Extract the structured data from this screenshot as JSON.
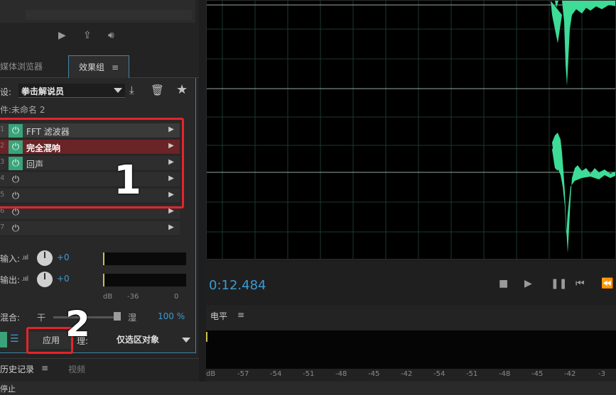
{
  "effects_rack": {
    "tabs": {
      "media_browser": "媒体浏览器",
      "effects_group": "效果组",
      "menu": "≡"
    },
    "preset_label": "设:",
    "preset_value": "拳击解说员",
    "file_label": "件:未命名 2",
    "slots": [
      {
        "num": "1",
        "name": "FFT 滤波器",
        "power_on": true
      },
      {
        "num": "2",
        "name": "完全混响",
        "power_on": true
      },
      {
        "num": "3",
        "name": "回声",
        "power_on": true
      },
      {
        "num": "4",
        "name": "",
        "power_on": false
      },
      {
        "num": "5",
        "name": "",
        "power_on": false
      },
      {
        "num": "6",
        "name": "",
        "power_on": false
      },
      {
        "num": "7",
        "name": "",
        "power_on": false
      }
    ],
    "input_label": "输入:",
    "input_value": "+0",
    "output_label": "输出:",
    "output_value": "+0",
    "meter_scale": [
      "dB",
      "-36",
      "0"
    ],
    "mix_label": "混合:",
    "mix_dry": "干",
    "mix_wet": "湿",
    "mix_value": "100 %",
    "apply_label": "应用",
    "process_label": "理:",
    "process_value": "仅选区对象"
  },
  "annotations": {
    "badge1": "1",
    "badge2": "2"
  },
  "bottom_tabs": {
    "history": "历史记录",
    "menu": "≡",
    "video": "视频"
  },
  "status": "停止",
  "editor": {
    "time": "0:12.484",
    "levels_title": "电平",
    "levels_menu": "≡",
    "levels_scale": [
      "dB",
      "-57",
      "-54",
      "-51",
      "-48",
      "-45",
      "-42",
      "-54",
      "-51",
      "-48",
      "-45",
      "-42",
      "-3"
    ]
  },
  "colors": {
    "accent": "#3a9bd2",
    "power_on": "#3aa37a",
    "waveform": "#3ddc97",
    "highlight": "#e4242a"
  }
}
